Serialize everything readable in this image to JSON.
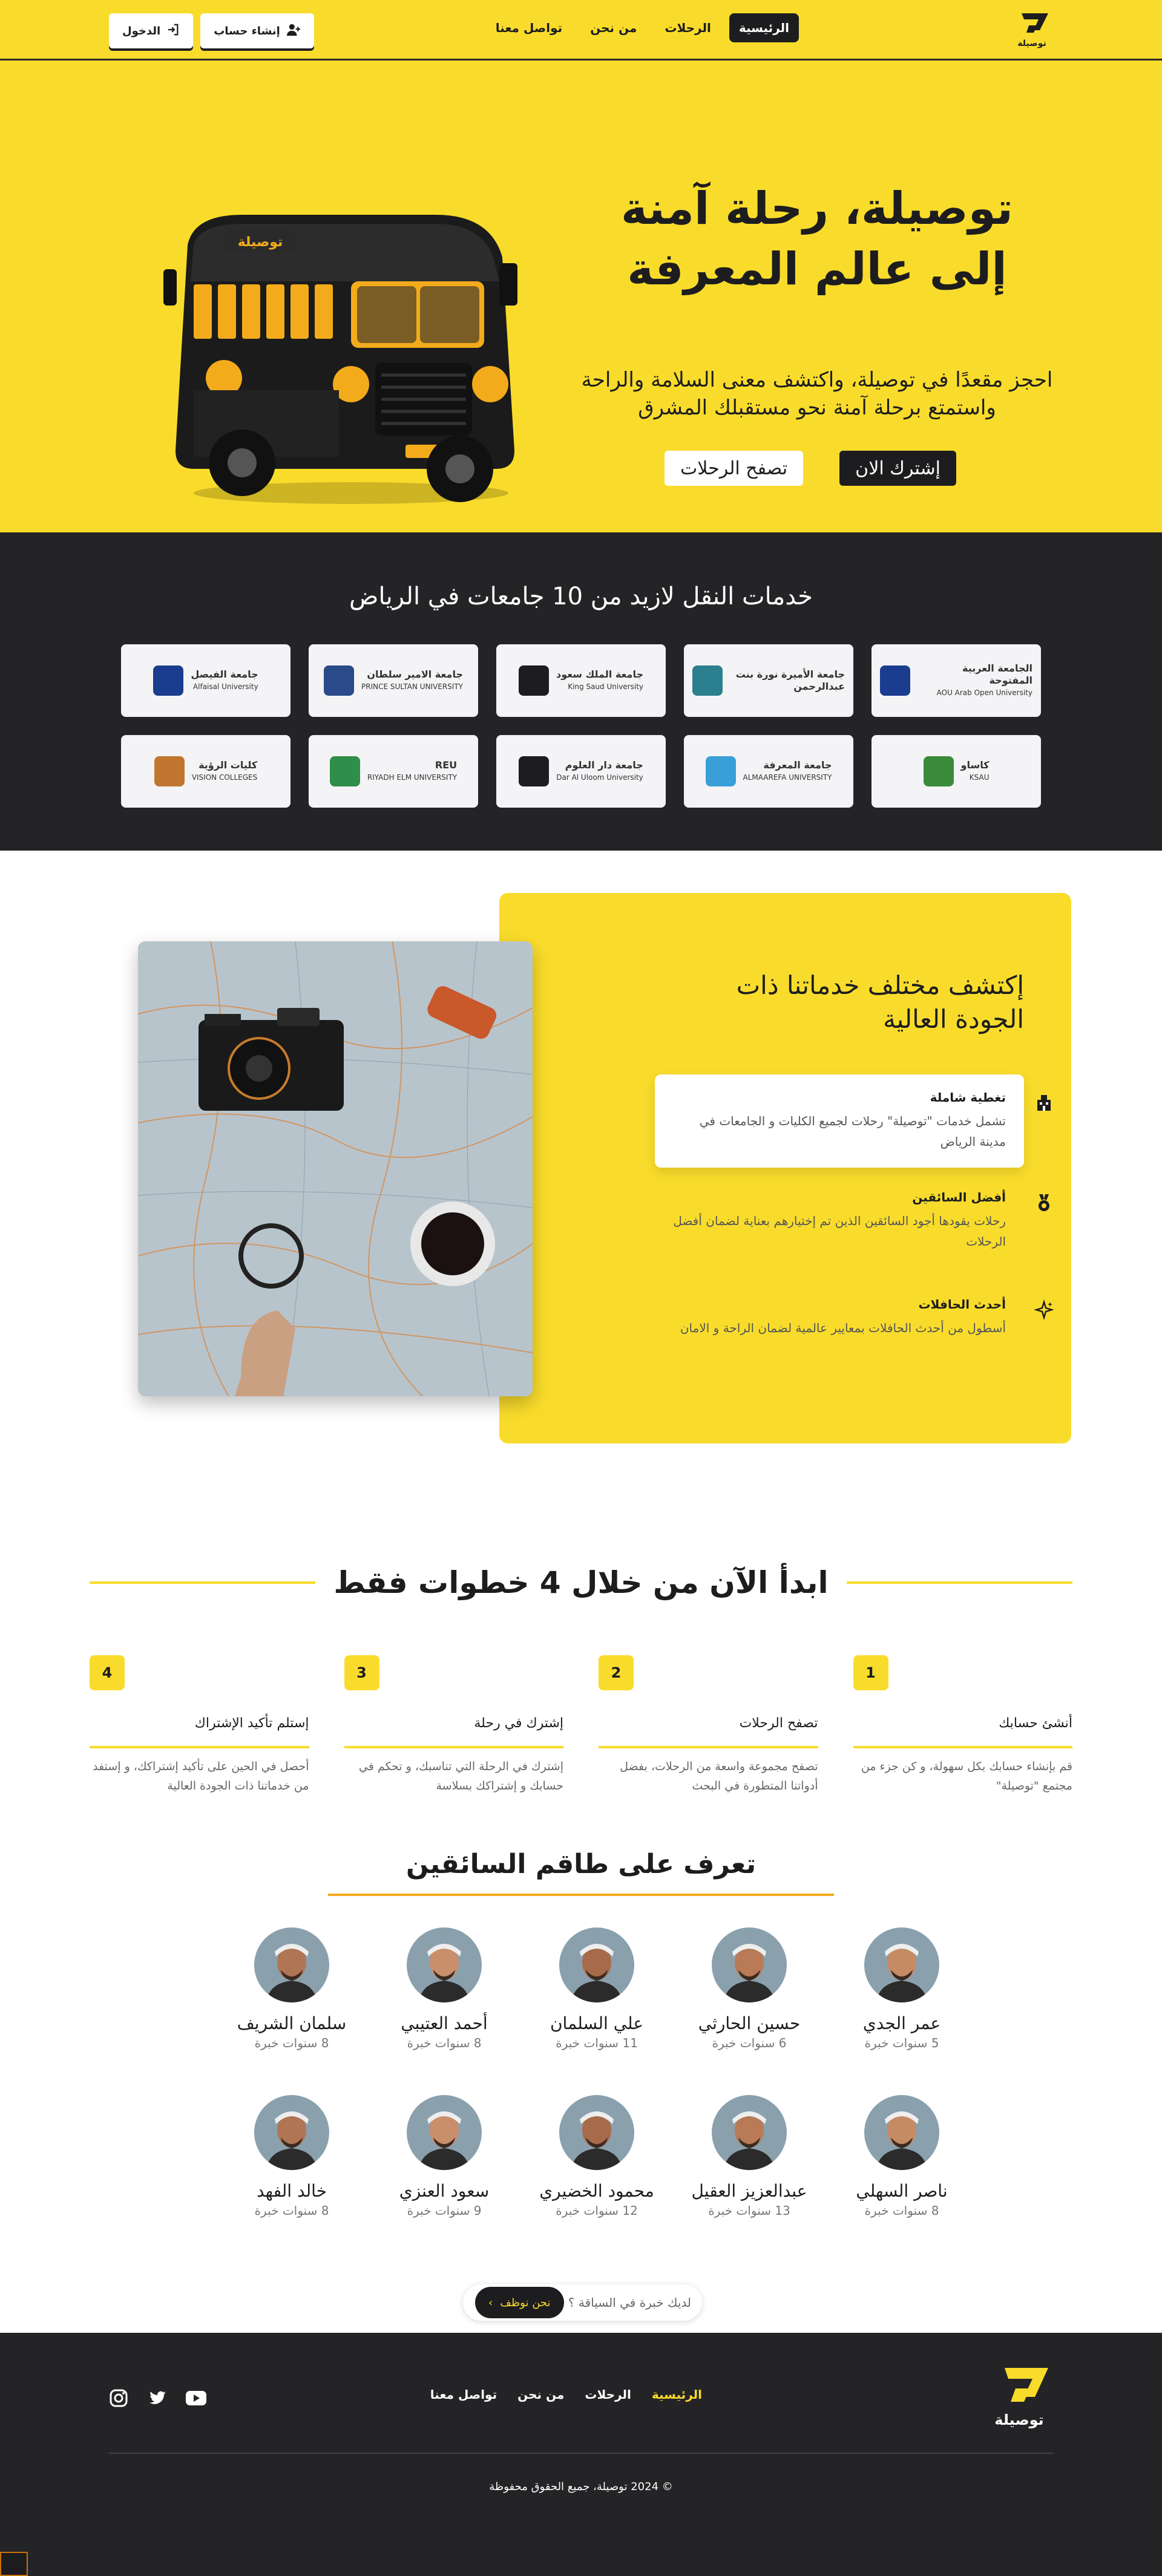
{
  "nav": {
    "links": [
      "الرئيسية",
      "الرحلات",
      "من نحن",
      "تواصل معنا"
    ],
    "login": "الدخول",
    "signup": "إنشاء حساب",
    "logo_text": "توصيلة"
  },
  "hero": {
    "title": "توصيلة، رحلة آمنة إلى عالم المعرفة",
    "subtitle": "احجز مقعدًا في توصيلة، واكتشف معنى السلامة والراحة واستمتع برحلة آمنة نحو مستقبلك المشرق",
    "subscribe": "إشترك الان",
    "browse": "تصفح الرحلات",
    "bus_label": "توصيلة"
  },
  "universities": {
    "title": "خدمات النقل لازيد من 10 جامعات في الرياض",
    "items": [
      {
        "name": "الجامعة العربية المفتوحة",
        "sub": "AOU Arab Open University",
        "color": "#1b3d8f"
      },
      {
        "name": "جامعة الأميرة نورة بنت عبدالرحمن",
        "sub": "",
        "color": "#2b7f8e"
      },
      {
        "name": "جامعة الملك سعود",
        "sub": "King Saud University",
        "color": "#1d1d1f"
      },
      {
        "name": "جامعة الامير سلطان",
        "sub": "PRINCE SULTAN UNIVERSITY",
        "color": "#2a4a8a"
      },
      {
        "name": "جامعة الفيصل",
        "sub": "Alfaisal University",
        "color": "#1b3d8f"
      },
      {
        "name": "كاساو",
        "sub": "KSAU",
        "color": "#3a8c3a"
      },
      {
        "name": "جامعة المعرفة",
        "sub": "ALMAAREFA UNIVERSITY",
        "color": "#3a9fd6"
      },
      {
        "name": "جامعة دار العلوم",
        "sub": "Dar Al Uloom University",
        "color": "#1d1d1f"
      },
      {
        "name": "REU",
        "sub": "RIYADH ELM UNIVERSITY",
        "color": "#2f8f4a"
      },
      {
        "name": "كليات الرؤية",
        "sub": "VISION COLLEGES",
        "color": "#c0762f"
      }
    ]
  },
  "services": {
    "title": "إكتشف مختلف خدماتنا ذات الجودة العالية",
    "items": [
      {
        "head": "تغطية شاملة",
        "desc": "تشمل خدمات \"توصيلة\" رحلات لجميع الكليات و الجامعات في مدينة الرياض",
        "icon": "building-icon"
      },
      {
        "head": "أفضل السائقين",
        "desc": "رحلات يقودها أجود السائقين الذين تم إختيارهم بعناية لضمان أفضل الرحلات",
        "icon": "medal-icon"
      },
      {
        "head": "أحدث الحافلات",
        "desc": "أسطول من أحدث الحافلات بمعايير عالمية لضمان الراحة و الامان",
        "icon": "sparkle-icon"
      }
    ]
  },
  "steps": {
    "title": "ابدأ الآن من خلال 4 خطوات فقط",
    "items": [
      {
        "num": "1",
        "name": "أنشئ حسابك",
        "text": "قم بإنشاء حسابك بكل سهولة، و كن جزء من مجتمع \"توصيلة\""
      },
      {
        "num": "2",
        "name": "تصفح الرحلات",
        "text": "تصفح مجموعة واسعة من الرحلات، بفضل أدواتنا المتطورة في البحث"
      },
      {
        "num": "3",
        "name": "إشترك في رحلة",
        "text": "إشترك في الرحلة التي تناسبك، و تحكم في حسابك و إشتراكك بسلاسة"
      },
      {
        "num": "4",
        "name": "إستلم تأكيد الإشتراك",
        "text": "أحصل في الحين على تأكيد إشتراكك، و إستفد من خدماتنا ذات الجودة العالية"
      }
    ]
  },
  "drivers": {
    "title": "تعرف على طاقم السائقين",
    "items": [
      {
        "name": "عمر الجدي",
        "exp": "5 سنوات خبرة"
      },
      {
        "name": "حسين الحارثي",
        "exp": "6 سنوات خبرة"
      },
      {
        "name": "علي السلمان",
        "exp": "11 سنوات خبرة"
      },
      {
        "name": "أحمد العتيبي",
        "exp": "8 سنوات خبرة"
      },
      {
        "name": "سلمان الشريف",
        "exp": "8 سنوات خبرة"
      },
      {
        "name": "ناصر السهلي",
        "exp": "8 سنوات خبرة"
      },
      {
        "name": "عبدالعزيز العقيل",
        "exp": "13 سنوات خبرة"
      },
      {
        "name": "محمود الخضيري",
        "exp": "12 سنوات خبرة"
      },
      {
        "name": "سعود العنزي",
        "exp": "9 سنوات خبرة"
      },
      {
        "name": "خالد الفهد",
        "exp": "8 سنوات خبرة"
      }
    ],
    "cta_question": "لديك خبرة في السياقة ؟",
    "cta_button": "نحن نوظف"
  },
  "footer": {
    "links": [
      "الرئيسية",
      "الرحلات",
      "من نحن",
      "تواصل معنا"
    ],
    "copyright": "© 2024 توصيلة، جميع الحقوق محفوظة",
    "logo_text": "توصيلة",
    "social": [
      "youtube-icon",
      "twitter-icon",
      "instagram-icon"
    ]
  },
  "colors": {
    "brand_yellow": "#f9dc2b",
    "dark": "#242427",
    "accent_orange": "#f3ab1c"
  }
}
